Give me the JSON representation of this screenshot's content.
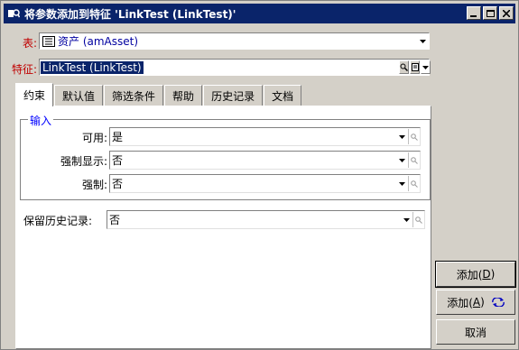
{
  "window": {
    "title": "将参数添加到特征 'LinkTest (LinkTest)'"
  },
  "table_field": {
    "label": "表:",
    "value": "资产 (amAsset)"
  },
  "feature_field": {
    "label": "特征:",
    "value": "LinkTest (LinkTest)"
  },
  "tabs": [
    {
      "label": "约束"
    },
    {
      "label": "默认值"
    },
    {
      "label": "筛选条件"
    },
    {
      "label": "帮助"
    },
    {
      "label": "历史记录"
    },
    {
      "label": "文档"
    }
  ],
  "input_group": {
    "title": "输入",
    "available": {
      "label": "可用:",
      "value": "是"
    },
    "force_display": {
      "label": "强制显示:",
      "value": "否"
    },
    "forced": {
      "label": "强制:",
      "value": "否"
    }
  },
  "history": {
    "label": "保留历史记录:",
    "value": "否"
  },
  "buttons": {
    "add_prefix": "添加(",
    "add_key": "D",
    "add_suffix": ")",
    "add_more_prefix": "添加(",
    "add_more_key": "A",
    "add_more_suffix": ")",
    "cancel": "取消"
  },
  "colors": {
    "title_bar": "#0a246a",
    "required_label": "#c00000",
    "group_title": "#0000ff",
    "selection": "#0a246a"
  }
}
